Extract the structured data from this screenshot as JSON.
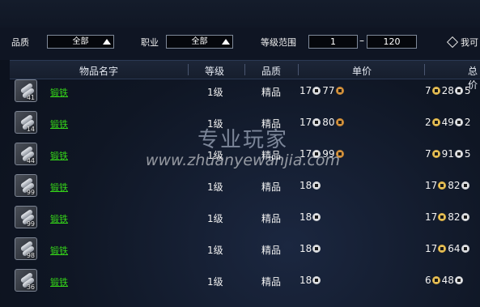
{
  "filters": {
    "quality_label": "品质",
    "quality_value": "全部",
    "class_label": "职业",
    "class_value": "全部",
    "level_range_label": "等级范围",
    "level_min": "1",
    "level_max": "120",
    "usable_label": "我可"
  },
  "table": {
    "headers": [
      "物品名字",
      "等级",
      "品质",
      "单价",
      "总价"
    ],
    "rows": [
      {
        "count": "41",
        "name": "锻铁",
        "level": "1级",
        "quality": "精品",
        "price": [
          "17",
          "silver",
          "77",
          "copper"
        ],
        "total": [
          "7",
          "gold",
          "28",
          "silver",
          "5"
        ]
      },
      {
        "count": "14",
        "name": "锻铁",
        "level": "1级",
        "quality": "精品",
        "price": [
          "17",
          "silver",
          "80",
          "copper"
        ],
        "total": [
          "2",
          "gold",
          "49",
          "silver",
          "2"
        ]
      },
      {
        "count": "44",
        "name": "锻铁",
        "level": "1级",
        "quality": "精品",
        "price": [
          "17",
          "silver",
          "99",
          "copper"
        ],
        "total": [
          "7",
          "gold",
          "91",
          "silver",
          "5"
        ]
      },
      {
        "count": "99",
        "name": "锻铁",
        "level": "1级",
        "quality": "精品",
        "price": [
          "18",
          "silver",
          "",
          ""
        ],
        "total": [
          "17",
          "gold",
          "82",
          "silver",
          ""
        ]
      },
      {
        "count": "99",
        "name": "锻铁",
        "level": "1级",
        "quality": "精品",
        "price": [
          "18",
          "silver",
          "",
          ""
        ],
        "total": [
          "17",
          "gold",
          "82",
          "silver",
          ""
        ]
      },
      {
        "count": "98",
        "name": "锻铁",
        "level": "1级",
        "quality": "精品",
        "price": [
          "18",
          "silver",
          "",
          ""
        ],
        "total": [
          "17",
          "gold",
          "64",
          "silver",
          ""
        ]
      },
      {
        "count": "36",
        "name": "锻铁",
        "level": "1级",
        "quality": "精品",
        "price": [
          "18",
          "silver",
          "",
          ""
        ],
        "total": [
          "6",
          "gold",
          "48",
          "silver",
          ""
        ]
      }
    ]
  },
  "watermark": {
    "line1": "专业玩家",
    "line2": "www.zhuanyewanjia.com"
  },
  "colors": {
    "item_name": "#35d419",
    "gold_coin": "#e0b040",
    "silver_coin": "#d8dbe0",
    "copper_coin": "#d08a30"
  }
}
